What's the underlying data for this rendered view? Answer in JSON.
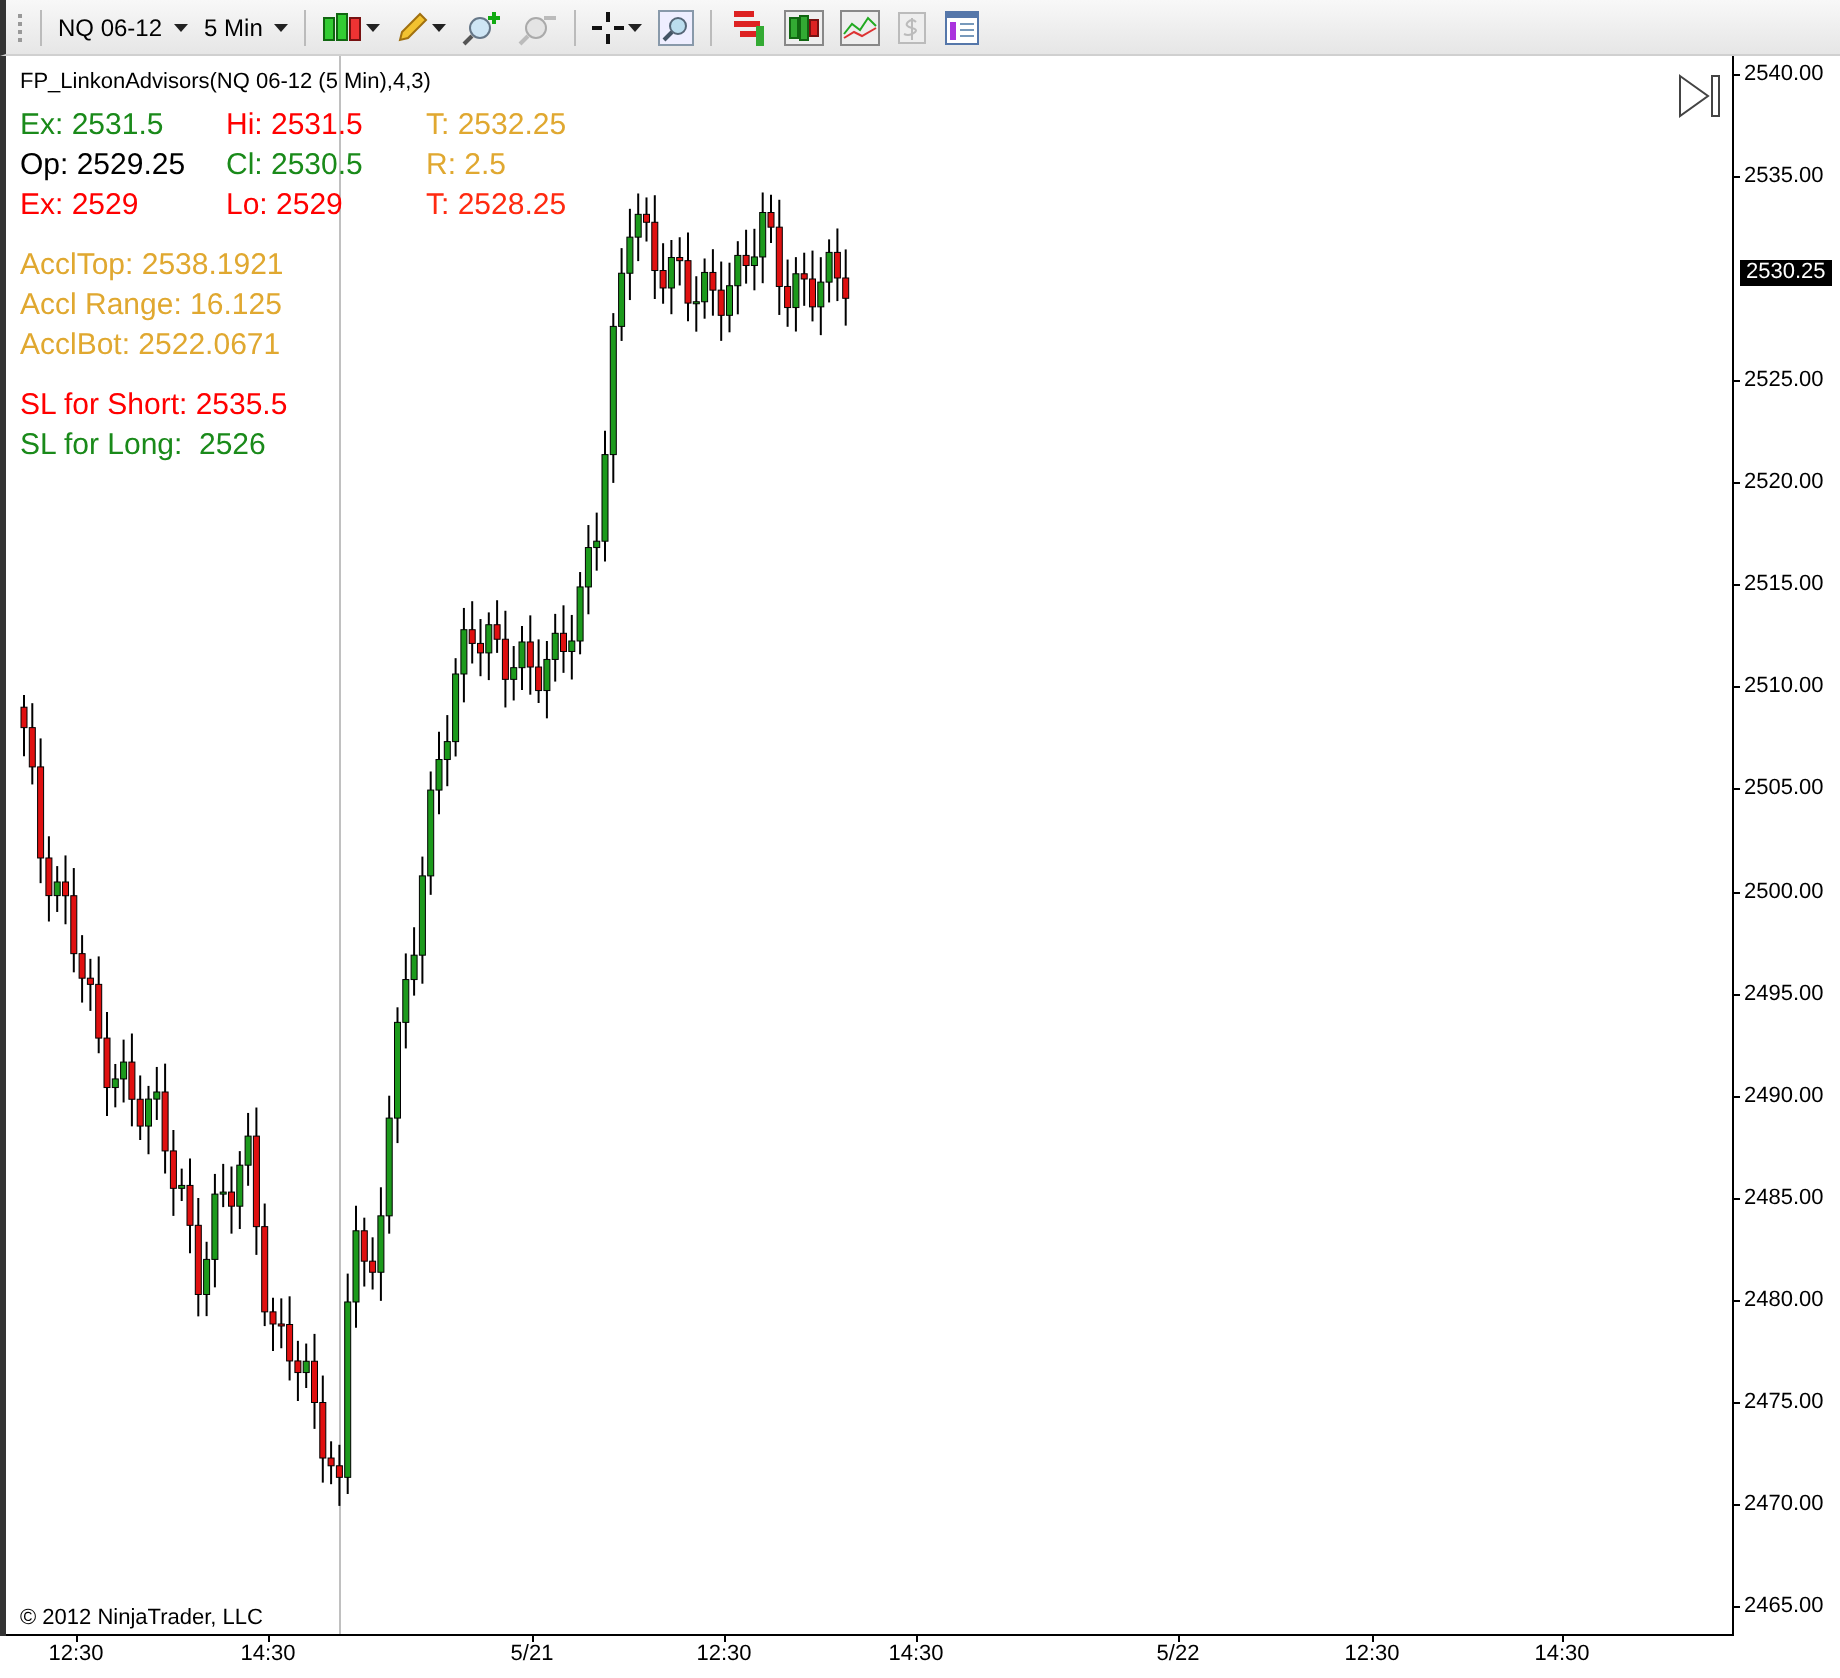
{
  "toolbar": {
    "instrument": "NQ 06-12",
    "interval": "5 Min"
  },
  "chart": {
    "title": "FP_LinkonAdvisors(NQ 06-12 (5 Min),4,3)",
    "info_rows": [
      [
        {
          "text": "Ex: 2531.5",
          "color": "#1a8a1a"
        },
        {
          "text": "Hi: 2531.5",
          "color": "#ff0000"
        },
        {
          "text": "T: 2532.25",
          "color": "#e0a830"
        }
      ],
      [
        {
          "text": "Op: 2529.25",
          "color": "#000000"
        },
        {
          "text": "Cl: 2530.5",
          "color": "#1a8a1a"
        },
        {
          "text": "R: 2.5",
          "color": "#e0a830"
        }
      ],
      [
        {
          "text": "Ex: 2529",
          "color": "#ff0000"
        },
        {
          "text": "Lo: 2529",
          "color": "#ff0000"
        },
        {
          "text": "T: 2528.25",
          "color": "#ff2a10"
        }
      ]
    ],
    "levels": [
      {
        "text": "AcclTop: 2538.1921",
        "color": "#e0a830"
      },
      {
        "text": "Accl Range: 16.125",
        "color": "#e0a830"
      },
      {
        "text": "AcclBot: 2522.0671",
        "color": "#e0a830"
      }
    ],
    "stops": [
      {
        "text": "SL for Short: 2535.5",
        "color": "#ff0000"
      },
      {
        "text": "SL for Long:  2526",
        "color": "#1a8a1a"
      }
    ],
    "last_price": "2530.25",
    "copyright": "© 2012 NinjaTrader, LLC",
    "y_axis": {
      "ticks_above": [
        "2540.00",
        "2535.00"
      ],
      "ticks_below": [
        "2525.00",
        "2520.00",
        "2515.00",
        "2510.00",
        "2505.00",
        "2500.00",
        "2495.00",
        "2490.00",
        "2485.00",
        "2480.00",
        "2475.00",
        "2470.00",
        "2465.00"
      ]
    },
    "x_axis": {
      "ticks": [
        "12:30",
        "14:30",
        "5/21",
        "12:30",
        "14:30",
        "5/22",
        "12:30",
        "14:30"
      ]
    }
  }
}
